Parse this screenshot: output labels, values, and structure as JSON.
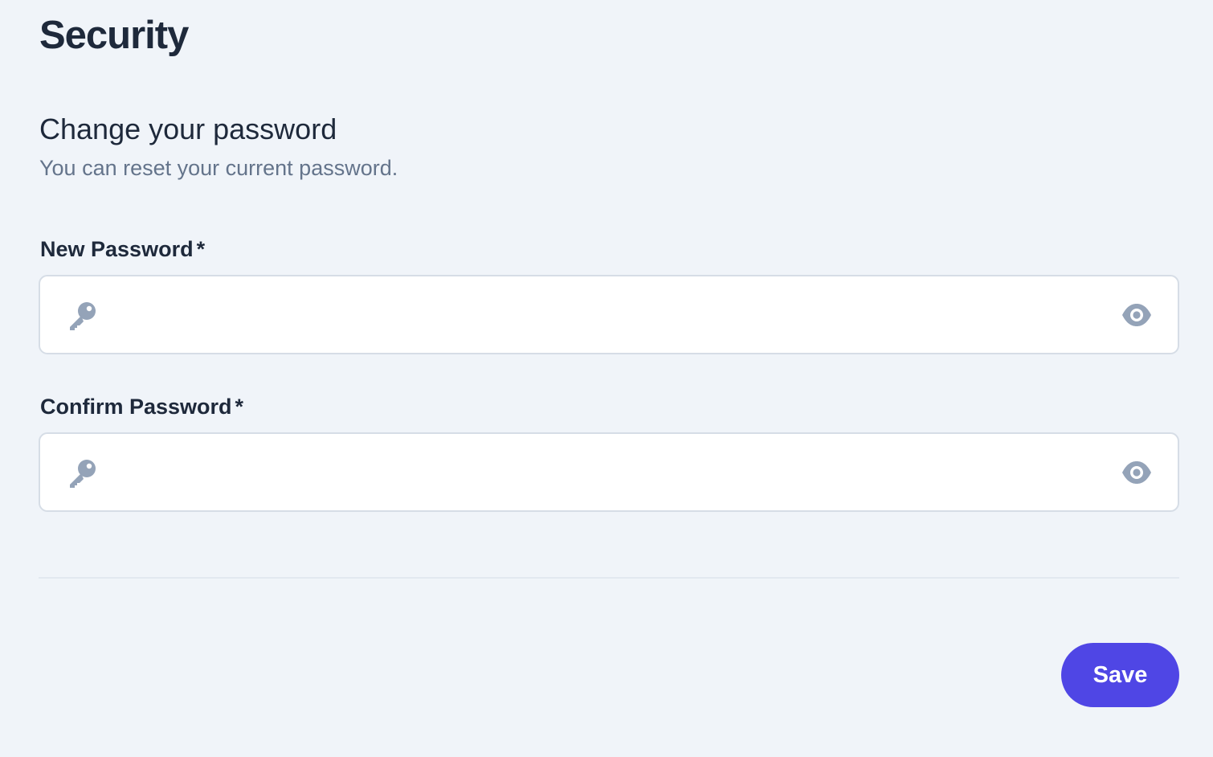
{
  "page": {
    "title": "Security"
  },
  "section": {
    "title": "Change your password",
    "subtitle": "You can reset your current password."
  },
  "fields": {
    "new_password": {
      "label": "New Password",
      "required_mark": "*",
      "value": "",
      "placeholder": "",
      "leading_icon": "key-icon",
      "trailing_icon": "eye-icon"
    },
    "confirm_password": {
      "label": "Confirm Password",
      "required_mark": "*",
      "value": "",
      "placeholder": "",
      "leading_icon": "key-icon",
      "trailing_icon": "eye-icon"
    }
  },
  "actions": {
    "save_label": "Save"
  },
  "colors": {
    "background": "#f0f4f9",
    "accent": "#4f46e5",
    "icon": "#94a3b8",
    "heading": "#1e293b",
    "muted_text": "#64748b"
  }
}
